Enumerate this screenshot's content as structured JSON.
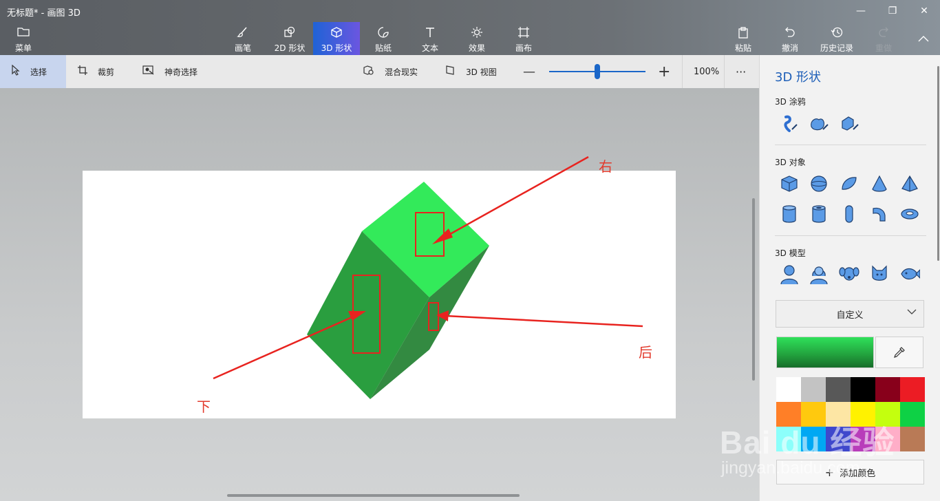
{
  "window": {
    "title": "无标题* - 画图 3D"
  },
  "menu": {
    "label": "菜单",
    "icon": "folder-icon"
  },
  "main_tools": [
    {
      "label": "画笔",
      "icon": "brush-icon"
    },
    {
      "label": "2D 形状",
      "icon": "2d-shapes-icon"
    },
    {
      "label": "3D 形状",
      "icon": "3d-shapes-icon"
    },
    {
      "label": "贴纸",
      "icon": "stickers-icon"
    },
    {
      "label": "文本",
      "icon": "text-icon"
    },
    {
      "label": "效果",
      "icon": "effects-icon"
    },
    {
      "label": "画布",
      "icon": "canvas-icon"
    }
  ],
  "right_tools": [
    {
      "label": "粘贴",
      "icon": "paste-icon"
    },
    {
      "label": "撤消",
      "icon": "undo-icon"
    },
    {
      "label": "历史记录",
      "icon": "history-icon"
    },
    {
      "label": "重做",
      "icon": "redo-icon"
    }
  ],
  "subbar": {
    "select": "选择",
    "crop": "裁剪",
    "magic_select": "神奇选择",
    "mixed_reality": "混合现实",
    "view3d": "3D 视图",
    "zoom_value": "100%",
    "zoom_fraction": 0.5
  },
  "annotations": {
    "right": "右",
    "back": "后",
    "bottom": "下"
  },
  "panel": {
    "title": "3D 形状",
    "doodle_label": "3D 涂鸦",
    "objects_label": "3D 对象",
    "models_label": "3D 模型",
    "color_dropdown": "自定义",
    "add_color": "添加颜色",
    "current_color": "#2ed158",
    "palette": [
      "#ffffff",
      "#c3c3c3",
      "#585858",
      "#000000",
      "#88001b",
      "#ec1c24",
      "#ff7f27",
      "#ffc90e",
      "#fde6a4",
      "#fff200",
      "#c4ff0e",
      "#0ed145",
      "#8cfffb",
      "#00a8f3",
      "#3f48cc",
      "#b83dba",
      "#ffaec8",
      "#b97a56"
    ]
  },
  "watermark": {
    "brand": "Bai du 经验",
    "url": "jingyan.baidu.com"
  }
}
